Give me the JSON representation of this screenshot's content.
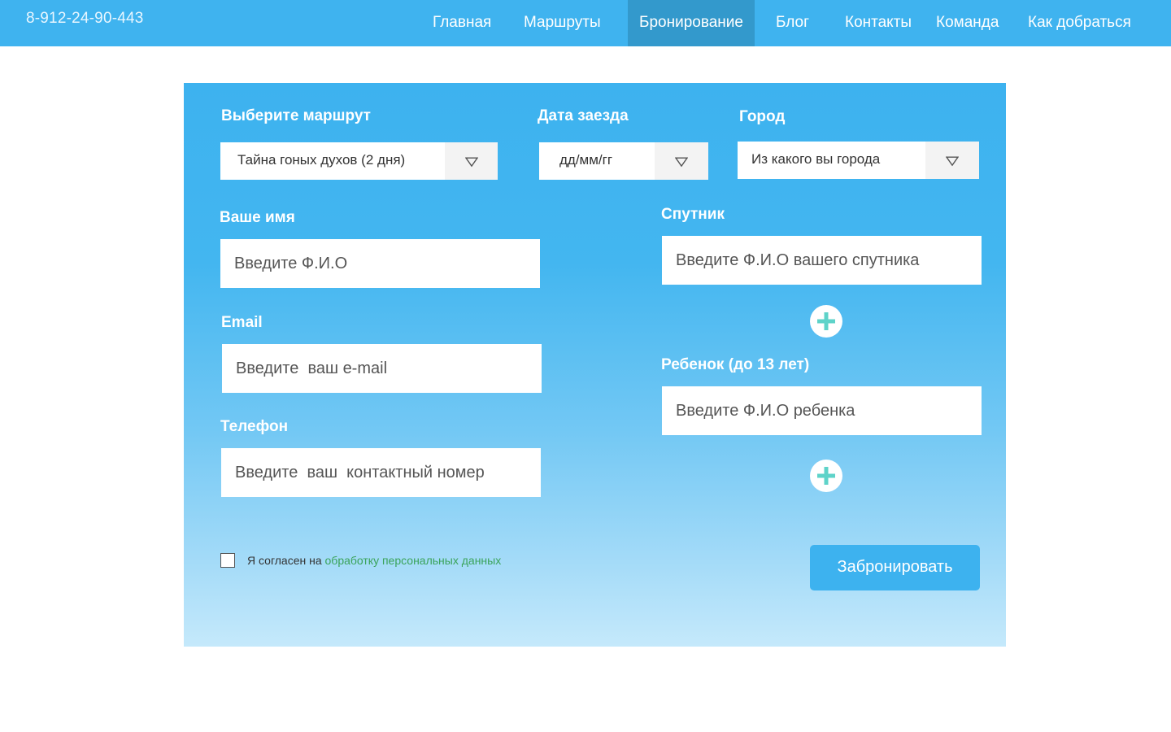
{
  "header": {
    "phone": "8-912-24-90-443",
    "nav": [
      {
        "label": "Главная"
      },
      {
        "label": "Маршруты"
      },
      {
        "label": "Бронирование",
        "active": true
      },
      {
        "label": "Блог"
      },
      {
        "label": "Контакты"
      },
      {
        "label": "Команда"
      },
      {
        "label": "Как добраться"
      }
    ]
  },
  "form": {
    "route": {
      "label": "Выберите маршрут",
      "value": "Тайна гоных духов  (2 дня)"
    },
    "date": {
      "label": "Дата заезда",
      "value": "дд/мм/гг"
    },
    "city": {
      "label": "Город",
      "value": "Из какого вы города"
    },
    "name": {
      "label": "Ваше имя",
      "placeholder": "Введите Ф.И.О"
    },
    "email": {
      "label": "Email",
      "placeholder": "Введите  ваш e-mail"
    },
    "phone": {
      "label": "Телефон",
      "placeholder": "Введите  ваш  контактный номер"
    },
    "companion": {
      "label": "Спутник",
      "placeholder": "Введите Ф.И.О вашего спутника"
    },
    "child": {
      "label": "Ребенок (до 13 лет)",
      "placeholder": "Введите Ф.И.О ребенка"
    },
    "consent": {
      "prefix": "Я согласен на ",
      "link": "обработку персональных данных",
      "checked": false
    },
    "submit_label": "Забронировать"
  },
  "colors": {
    "header_bg": "#3fb3ef",
    "nav_active_bg": "#3399cc",
    "plus_icon": "#5ed3c9",
    "consent_link": "#3aa35a"
  }
}
